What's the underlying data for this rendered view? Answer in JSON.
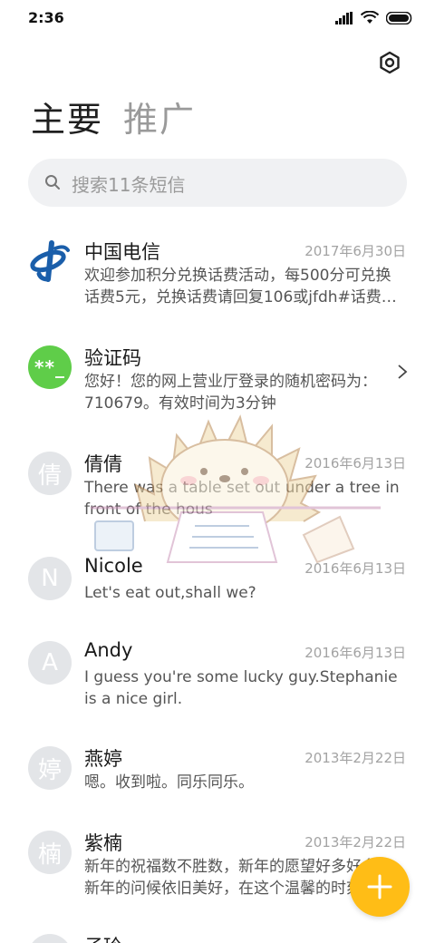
{
  "status_bar": {
    "time": "2:36"
  },
  "tabs": [
    {
      "label": "主要"
    },
    {
      "label": "推广"
    }
  ],
  "search": {
    "placeholder": "搜索11条短信"
  },
  "messages": [
    {
      "sender": "中国电信",
      "date": "2017年6月30日",
      "preview": "欢迎参加积分兑换话费活动，每500分可兑换话费5元，兑换话费请回复106或jfdh#话费…",
      "avatar": "telecom-logo"
    },
    {
      "sender": "验证码",
      "date": "",
      "preview": "您好！您的网上营业厅登录的随机密码为：710679。有效时间为3分钟",
      "avatar_text": "**_"
    },
    {
      "sender": "倩倩",
      "date": "2016年6月13日",
      "preview": "There was a table set out under a tree in front of the hous",
      "avatar_text": "倩"
    },
    {
      "sender": "Nicole",
      "date": "2016年6月13日",
      "preview": "Let's eat out,shall we?",
      "avatar_text": "N"
    },
    {
      "sender": "Andy",
      "date": "2016年6月13日",
      "preview": "I guess you're some lucky guy.Stephanie is a nice girl.",
      "avatar_text": "A"
    },
    {
      "sender": "燕婷",
      "date": "2013年2月22日",
      "preview": "嗯。收到啦。同乐同乐。",
      "avatar_text": "婷"
    },
    {
      "sender": "紫楠",
      "date": "2013年2月22日",
      "preview": "新年的祝福数不胜数，新年的愿望好多好多，新年的问候依旧美好，在这个温馨的时刻",
      "avatar_text": "楠"
    },
    {
      "sender": "子玲",
      "date": "",
      "preview": "",
      "avatar_text": ""
    }
  ],
  "colors": {
    "fab": "#ffbd16",
    "verify_avatar": "#5fcd49",
    "telecom_blue": "#1a5eaa"
  },
  "icons": {
    "settings": "gear-icon",
    "search": "search-icon",
    "compose": "plus-icon",
    "chevron": "chevron-right-icon"
  }
}
